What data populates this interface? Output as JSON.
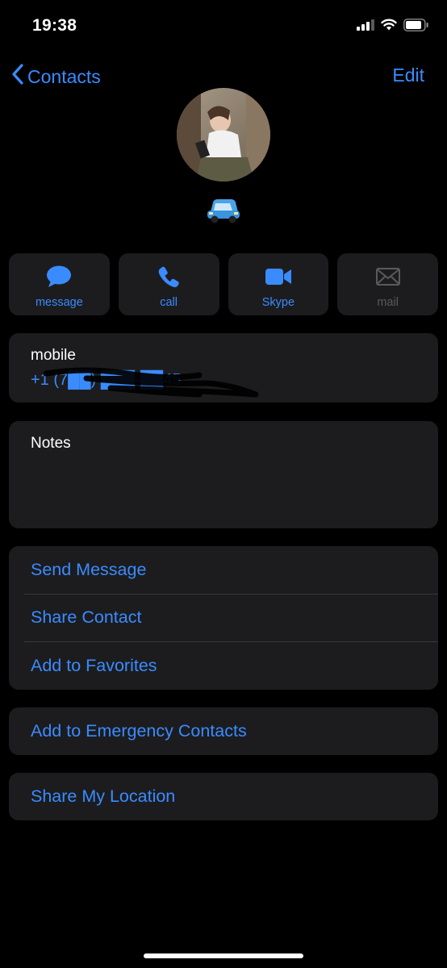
{
  "status_bar": {
    "time": "19:38",
    "icons": [
      "cellular-signal-icon",
      "wifi-icon",
      "battery-icon"
    ]
  },
  "nav": {
    "back_label": "Contacts",
    "edit_label": "Edit"
  },
  "contact": {
    "name_emoji": "🚙"
  },
  "actions": [
    {
      "label": "message",
      "icon": "message-bubble-icon",
      "enabled": true
    },
    {
      "label": "call",
      "icon": "phone-icon",
      "enabled": true
    },
    {
      "label": "Skype",
      "icon": "video-camera-icon",
      "enabled": true
    },
    {
      "label": "mail",
      "icon": "envelope-icon",
      "enabled": false
    }
  ],
  "phone": {
    "label": "mobile",
    "number": "+1 (7██) ███-██45"
  },
  "notes": {
    "label": "Notes"
  },
  "options": [
    "Send Message",
    "Share Contact",
    "Add to Favorites"
  ],
  "emergency": {
    "label": "Add to Emergency Contacts"
  },
  "location": {
    "label": "Share My Location"
  },
  "colors": {
    "background": "#000000",
    "card": "#1c1c1e",
    "accent": "#3a8bff",
    "divider": "#38383a",
    "disabled": "#5a5a5e"
  }
}
